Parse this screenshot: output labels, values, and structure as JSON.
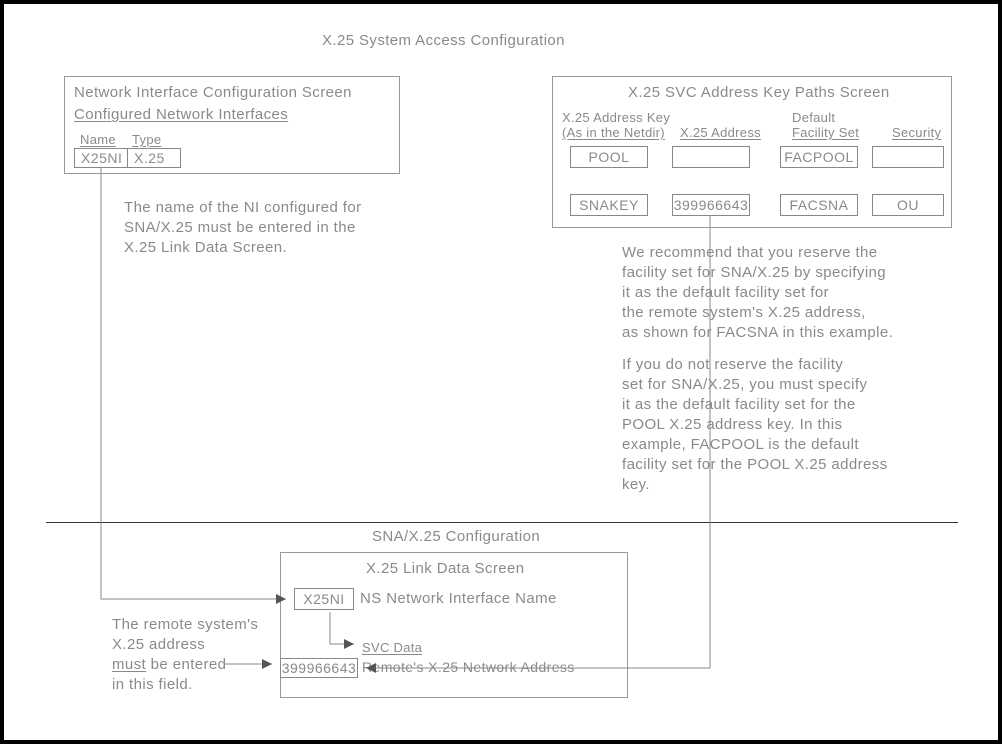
{
  "title": "X.25 System Access Configuration",
  "left_panel": {
    "title": "Network Interface Configuration Screen",
    "subtitle": "Configured Network Interfaces",
    "col1": "Name",
    "col2": "Type",
    "row_name": "X25NI",
    "row_type": "X.25"
  },
  "left_note_l1": "The name of the NI configured for",
  "left_note_l2": "SNA/X.25 must be entered in the",
  "left_note_l3": "X.25 Link Data Screen.",
  "right_panel": {
    "title": "X.25 SVC Address Key Paths Screen",
    "h_addrkey_l1": "X.25 Address Key",
    "h_addrkey_l2": "(As in the Netdir)",
    "h_addr": "X.25 Address",
    "h_fac_l1": "Default",
    "h_fac_l2": "Facility Set",
    "h_sec": "Security",
    "r1_key": "POOL",
    "r1_addr": "",
    "r1_fac": "FACPOOL",
    "r1_sec": "",
    "r2_key": "SNAKEY",
    "r2_addr": "399966643",
    "r2_fac": "FACSNA",
    "r2_sec": "OU"
  },
  "right_note1_l1": "We recommend that you reserve the",
  "right_note1_l2": "facility set for SNA/X.25 by specifying",
  "right_note1_l3": "it as the default facility set for",
  "right_note1_l4": "the remote system's X.25 address,",
  "right_note1_l5": "as shown for FACSNA in this example.",
  "right_note2_l1": "If you do not reserve the facility",
  "right_note2_l2": "set for SNA/X.25, you must specify",
  "right_note2_l3": "it as the default facility set for the",
  "right_note2_l4": "POOL X.25 address key.  In this",
  "right_note2_l5": "example, FACPOOL is the default",
  "right_note2_l6": "facility set for the POOL X.25 address",
  "right_note2_l7": "key.",
  "section2_title": "SNA/X.25 Configuration",
  "bottom_panel": {
    "title": "X.25 Link Data Screen",
    "f1_val": "X25NI",
    "f1_label": "NS Network Interface Name",
    "svc_label": "SVC Data",
    "f2_val": "399966643",
    "f2_label": "Remote's X.25 Network Address"
  },
  "bottom_note_l1": "The remote system's",
  "bottom_note_l2": "X.25 address",
  "bottom_note_l3a": "must",
  "bottom_note_l3b": " be entered",
  "bottom_note_l4": "in this field."
}
